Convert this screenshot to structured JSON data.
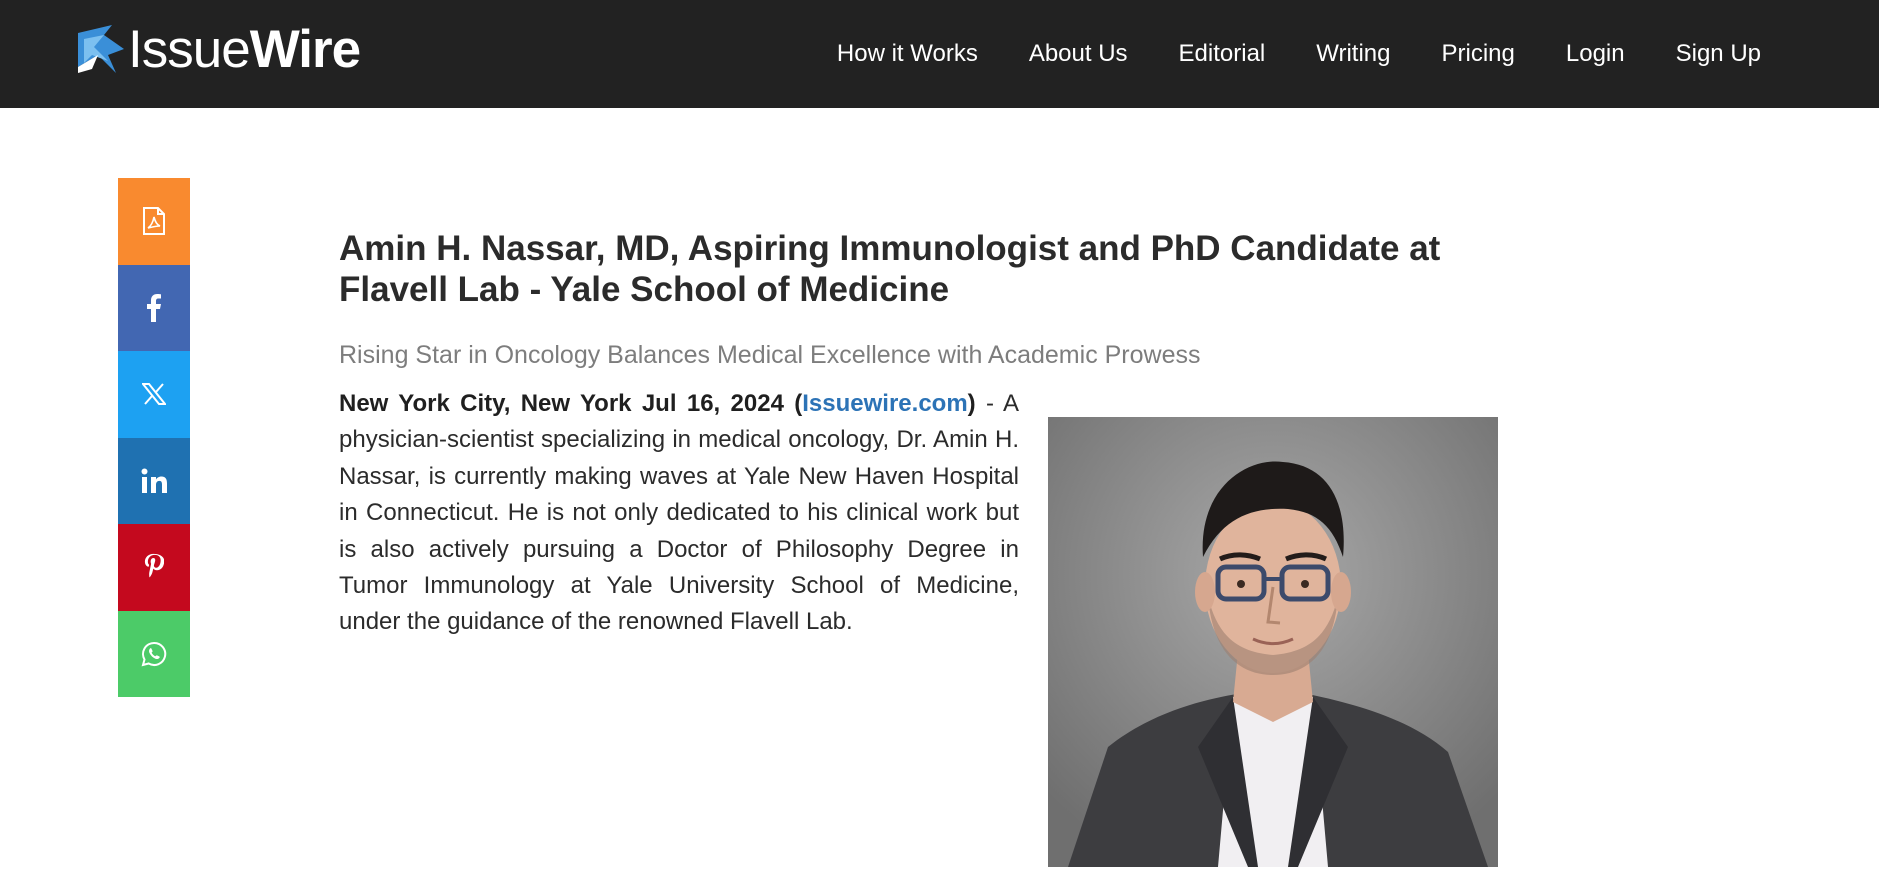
{
  "header": {
    "logo": {
      "part1": "Issue",
      "part2": "Wire"
    },
    "nav": [
      "How it Works",
      "About Us",
      "Editorial",
      "Writing",
      "Pricing",
      "Login",
      "Sign Up"
    ]
  },
  "share": [
    {
      "name": "pdf",
      "icon": "pdf-icon",
      "color": "#f98a2f"
    },
    {
      "name": "facebook",
      "icon": "facebook-icon",
      "color": "#4267b2"
    },
    {
      "name": "x",
      "icon": "x-icon",
      "color": "#1da1f2"
    },
    {
      "name": "linkedin",
      "icon": "linkedin-icon",
      "color": "#1f71b1"
    },
    {
      "name": "pinterest",
      "icon": "pinterest-icon",
      "color": "#c4091e"
    },
    {
      "name": "whatsapp",
      "icon": "whatsapp-icon",
      "color": "#4ccb68"
    }
  ],
  "article": {
    "title": "Amin H. Nassar, MD, Aspiring Immunologist and PhD Candidate at Flavell Lab - Yale School of Medicine",
    "subtitle": "Rising Star in Oncology Balances Medical Excellence with Academic Prowess",
    "dateline_prefix": "New York City, New York Jul 16, 2024 (",
    "source": "Issuewire.com",
    "dateline_suffix": ")",
    "body": " - A physician-scientist specializing in medical oncology, Dr. Amin H. Nassar, is currently making waves at Yale New Haven Hospital in Connecticut. He is not only dedicated to his clinical work but is also actively pursuing a Doctor of Philosophy Degree in Tumor Immunology at Yale University School of Medicine, under the guidance of the renowned Flavell Lab."
  },
  "colors": {
    "header_bg": "#222222",
    "link": "#2c73b6",
    "subtitle": "#7d7d7d"
  }
}
